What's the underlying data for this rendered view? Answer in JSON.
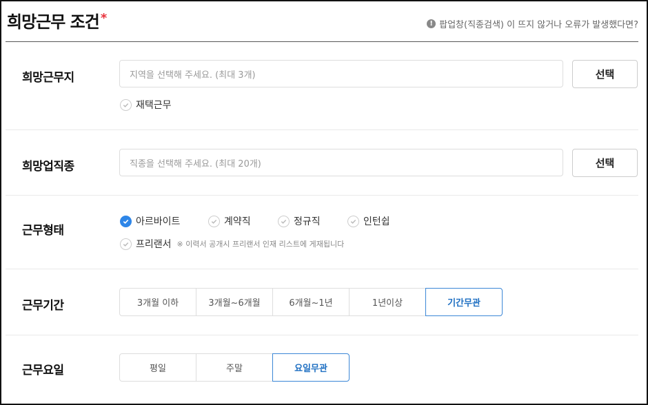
{
  "header": {
    "title": "희망근무 조건",
    "required_mark": "*",
    "help_text": "팝업창(직종검색) 이 뜨지 않거나 오류가 발생했다면?"
  },
  "location": {
    "label": "희망근무지",
    "placeholder": "지역을 선택해 주세요. (최대 3개)",
    "select_label": "선택",
    "remote_label": "재택근무",
    "remote_checked": false
  },
  "job": {
    "label": "희망업직종",
    "placeholder": "직종을 선택해 주세요. (최대 20개)",
    "select_label": "선택"
  },
  "employment": {
    "label": "근무형태",
    "options": [
      {
        "label": "아르바이트",
        "checked": true
      },
      {
        "label": "계약직",
        "checked": false
      },
      {
        "label": "정규직",
        "checked": false
      },
      {
        "label": "인턴쉽",
        "checked": false
      }
    ],
    "freelancer": {
      "label": "프리랜서",
      "checked": false,
      "note": "※ 이력서 공개시 프리랜서 인재 리스트에 게재됩니다"
    }
  },
  "period": {
    "label": "근무기간",
    "options": [
      "3개월 이하",
      "3개월~6개월",
      "6개월~1년",
      "1년이상",
      "기간무관"
    ],
    "selected": "기간무관"
  },
  "days": {
    "label": "근무요일",
    "options": [
      "평일",
      "주말",
      "요일무관"
    ],
    "selected": "요일무관"
  },
  "colors": {
    "accent": "#2e86e8",
    "required": "#e8323c"
  }
}
